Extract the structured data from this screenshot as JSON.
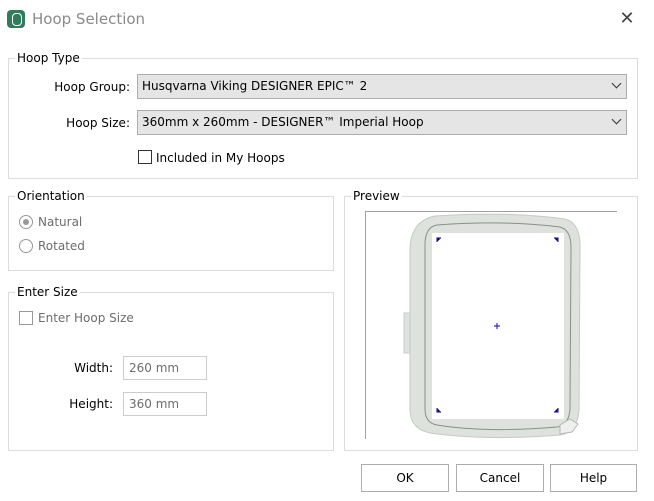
{
  "window": {
    "title": "Hoop Selection",
    "icon": "hoop-app-icon",
    "close_icon": "close-icon"
  },
  "hoop_type": {
    "legend": "Hoop Type",
    "group_label": "Hoop Group:",
    "group_value": "Husqvarna Viking DESIGNER EPIC™ 2",
    "size_label": "Hoop Size:",
    "size_value": "360mm x 260mm - DESIGNER™ Imperial Hoop",
    "included_label": "Included in My Hoops",
    "included_checked": false
  },
  "orientation": {
    "legend": "Orientation",
    "options": [
      {
        "label": "Natural",
        "selected": true
      },
      {
        "label": "Rotated",
        "selected": false
      }
    ]
  },
  "enter_size": {
    "legend": "Enter Size",
    "checkbox_label": "Enter Hoop Size",
    "checked": false,
    "width_label": "Width:",
    "width_value": "260 mm",
    "height_label": "Height:",
    "height_value": "360 mm"
  },
  "preview": {
    "legend": "Preview"
  },
  "buttons": {
    "ok": "OK",
    "cancel": "Cancel",
    "help": "Help"
  }
}
